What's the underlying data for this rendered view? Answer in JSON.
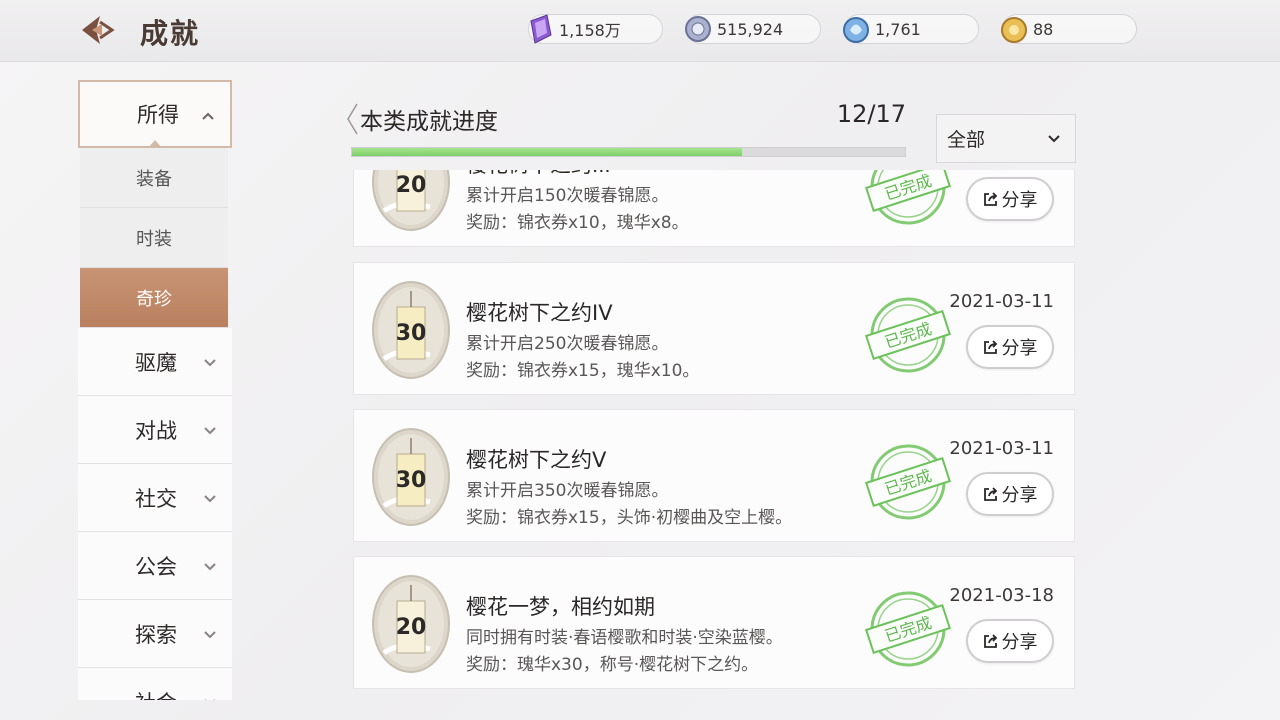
{
  "header": {
    "title": "成就",
    "back_icon": "back-arrow-icon"
  },
  "currencies": [
    {
      "icon": "purple-crystal-icon",
      "value": "1,158万",
      "color": "#8b5bd1"
    },
    {
      "icon": "silver-coin-icon",
      "value": "515,924",
      "color": "#8d96b8"
    },
    {
      "icon": "blue-gem-icon",
      "value": "1,761",
      "color": "#6aa0d8"
    },
    {
      "icon": "gold-token-icon",
      "value": "88",
      "color": "#e0b040"
    }
  ],
  "sidebar": {
    "categories": [
      {
        "label": "所得",
        "expanded": true
      },
      {
        "label": "驱魔"
      },
      {
        "label": "对战"
      },
      {
        "label": "社交"
      },
      {
        "label": "公会"
      },
      {
        "label": "探索"
      },
      {
        "label": "社会"
      }
    ],
    "subitems": [
      {
        "label": "装备"
      },
      {
        "label": "时装"
      },
      {
        "label": "奇珍",
        "selected": true
      }
    ]
  },
  "progress": {
    "title": "本类成就进度",
    "count": "12/17",
    "fraction": 0.706,
    "color": "#7fcf6b"
  },
  "filter": {
    "label": "全部"
  },
  "achievements": [
    {
      "points": "20",
      "title": "樱花树下之约III",
      "desc": "累计开启150次暖春锦愿。",
      "reward": "奖励：锦衣券x10，瑰华x8。",
      "status": "已完成",
      "date": "",
      "share": "分享"
    },
    {
      "points": "30",
      "title": "樱花树下之约IV",
      "desc": "累计开启250次暖春锦愿。",
      "reward": "奖励：锦衣券x15，瑰华x10。",
      "status": "已完成",
      "date": "2021-03-11",
      "share": "分享"
    },
    {
      "points": "30",
      "title": "樱花树下之约V",
      "desc": "累计开启350次暖春锦愿。",
      "reward": "奖励：锦衣券x15，头饰·初樱曲及空上樱。",
      "status": "已完成",
      "date": "2021-03-11",
      "share": "分享"
    },
    {
      "points": "20",
      "title": "樱花一梦，相约如期",
      "desc": "同时拥有时装·春语樱歌和时装·空染蓝樱。",
      "reward": "奖励：瑰华x30，称号·樱花树下之约。",
      "status": "已完成",
      "date": "2021-03-18",
      "share": "分享"
    }
  ],
  "colors": {
    "accent": "#c08a68",
    "stamp_green": "#6cc25a"
  }
}
